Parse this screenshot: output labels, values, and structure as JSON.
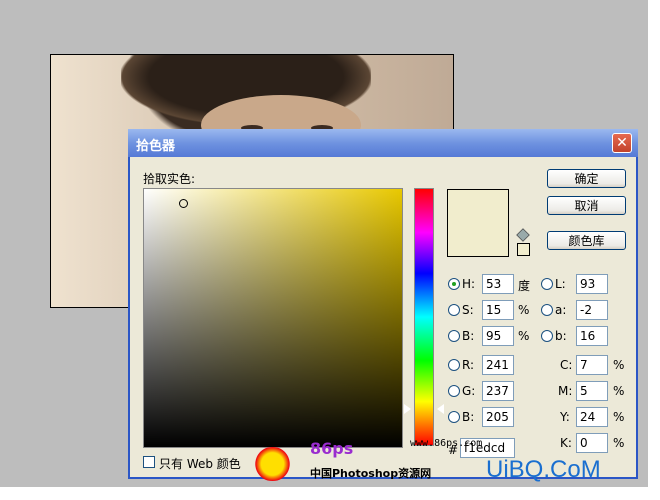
{
  "dialog": {
    "title": "拾色器",
    "close_label": "✕",
    "pick_label": "拾取实色:",
    "buttons": {
      "ok": "确定",
      "cancel": "取消",
      "library": "颜色库"
    },
    "web_only_label": "只有 Web 颜色",
    "hsb": [
      {
        "label": "H:",
        "value": "53",
        "unit": "度",
        "selected": true
      },
      {
        "label": "S:",
        "value": "15",
        "unit": "%",
        "selected": false
      },
      {
        "label": "B:",
        "value": "95",
        "unit": "%",
        "selected": false
      }
    ],
    "rgb": [
      {
        "label": "R:",
        "value": "241"
      },
      {
        "label": "G:",
        "value": "237"
      },
      {
        "label": "B:",
        "value": "205"
      }
    ],
    "lab": [
      {
        "label": "L:",
        "value": "93"
      },
      {
        "label": "a:",
        "value": "-2"
      },
      {
        "label": "b:",
        "value": "16"
      }
    ],
    "cmyk": [
      {
        "label": "C:",
        "value": "7",
        "unit": "%"
      },
      {
        "label": "M:",
        "value": "5",
        "unit": "%"
      },
      {
        "label": "Y:",
        "value": "24",
        "unit": "%"
      },
      {
        "label": "K:",
        "value": "0",
        "unit": "%"
      }
    ],
    "hex_label": "#",
    "hex_value": "f1edcd",
    "current_color": "#f1edcd"
  },
  "watermark": {
    "site_url": "www.86ps.com",
    "brand": "86ps",
    "site_name": "中国Photoshop资源网",
    "corner": "UiBQ.CoM"
  }
}
